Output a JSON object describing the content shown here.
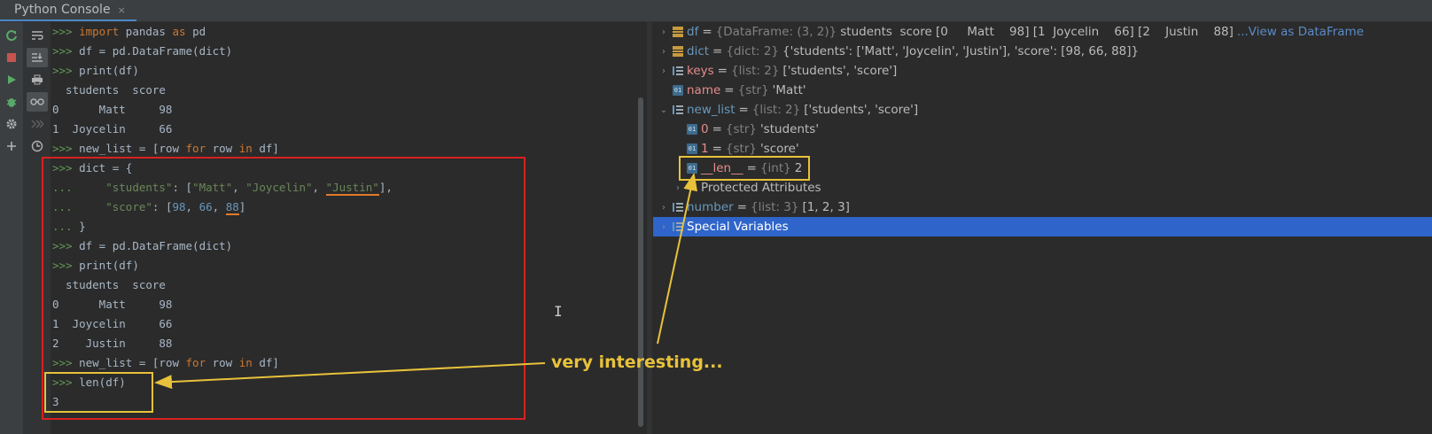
{
  "window": {
    "tab_title": "Python Console",
    "tab_close": "×"
  },
  "toolbar": {
    "icons": [
      "rerun-icon",
      "stop-icon",
      "run-icon",
      "debug-icon",
      "settings-icon",
      "add-icon"
    ]
  },
  "toolbar2": {
    "icons": [
      "soft-wrap-icon",
      "scroll-to-end-icon",
      "print-icon",
      "show-variables-icon",
      "history-forward-icon",
      "history-icon"
    ]
  },
  "console": {
    "prompt": ">>>",
    "continuation": "...",
    "lines": [
      {
        "prefix": ">>>",
        "code": [
          [
            "kw",
            "import"
          ],
          [
            "t",
            " pandas "
          ],
          [
            "kw",
            "as"
          ],
          [
            "t",
            " pd"
          ]
        ]
      },
      {
        "prefix": ">>>",
        "code": [
          [
            "t",
            "df = pd.DataFrame(dict)"
          ]
        ]
      },
      {
        "prefix": ">>>",
        "code": [
          [
            "t",
            "print(df)"
          ]
        ]
      },
      {
        "prefix": "",
        "code": [
          [
            "t",
            "  students  score"
          ]
        ]
      },
      {
        "prefix": "",
        "code": [
          [
            "t",
            "0      Matt     98"
          ]
        ]
      },
      {
        "prefix": "",
        "code": [
          [
            "t",
            "1  Joycelin     66"
          ]
        ]
      },
      {
        "prefix": ">>>",
        "code": [
          [
            "t",
            "new_list = [row "
          ],
          [
            "kw",
            "for"
          ],
          [
            "t",
            " row "
          ],
          [
            "kw",
            "in"
          ],
          [
            "t",
            " df]"
          ]
        ]
      },
      {
        "prefix": ">>>",
        "code": [
          [
            "t",
            "dict = {"
          ]
        ]
      },
      {
        "prefix": "...",
        "code": [
          [
            "t",
            "    "
          ],
          [
            "str",
            "\"students\""
          ],
          [
            "t",
            ": ["
          ],
          [
            "str",
            "\"Matt\""
          ],
          [
            "t",
            ", "
          ],
          [
            "str",
            "\"Joycelin\""
          ],
          [
            "t",
            ", "
          ],
          [
            "strul",
            "\"Justin\""
          ],
          [
            "t",
            "],"
          ]
        ]
      },
      {
        "prefix": "...",
        "code": [
          [
            "t",
            "    "
          ],
          [
            "str",
            "\"score\""
          ],
          [
            "t",
            ": ["
          ],
          [
            "num",
            "98"
          ],
          [
            "t",
            ", "
          ],
          [
            "num",
            "66"
          ],
          [
            "t",
            ", "
          ],
          [
            "numul",
            "88"
          ],
          [
            "t",
            "]"
          ]
        ]
      },
      {
        "prefix": "...",
        "code": [
          [
            "t",
            "}"
          ]
        ]
      },
      {
        "prefix": ">>>",
        "code": [
          [
            "t",
            "df = pd.DataFrame(dict)"
          ]
        ]
      },
      {
        "prefix": ">>>",
        "code": [
          [
            "t",
            "print(df)"
          ]
        ]
      },
      {
        "prefix": "",
        "code": [
          [
            "t",
            "  students  score"
          ]
        ]
      },
      {
        "prefix": "",
        "code": [
          [
            "t",
            "0      Matt     98"
          ]
        ]
      },
      {
        "prefix": "",
        "code": [
          [
            "t",
            "1  Joycelin     66"
          ]
        ]
      },
      {
        "prefix": "",
        "code": [
          [
            "t",
            "2    Justin     88"
          ]
        ]
      },
      {
        "prefix": ">>>",
        "code": [
          [
            "t",
            "new_list = [row "
          ],
          [
            "kw",
            "for"
          ],
          [
            "t",
            " row "
          ],
          [
            "kw",
            "in"
          ],
          [
            "t",
            " df]"
          ]
        ]
      },
      {
        "prefix": ">>>",
        "code": [
          [
            "t",
            "len(df)"
          ]
        ]
      },
      {
        "prefix": "",
        "code": [
          [
            "t",
            "3"
          ]
        ]
      }
    ]
  },
  "variables": [
    {
      "indent": 0,
      "chevron": "›",
      "icon": "df",
      "name": "df",
      "name_color": "blue",
      "type": "{DataFrame: (3, 2)}",
      "value": "students  score [0     Matt    98] [1  Joycelin    66] [2    Justin    88]",
      "link": "...View as DataFrame"
    },
    {
      "indent": 0,
      "chevron": "›",
      "icon": "df",
      "name": "dict",
      "name_color": "blue",
      "type": "{dict: 2}",
      "value": "{'students': ['Matt', 'Joycelin', 'Justin'], 'score': [98, 66, 88]}",
      "link": ""
    },
    {
      "indent": 0,
      "chevron": "›",
      "icon": "list",
      "name": "keys",
      "name_color": "red",
      "type": "{list: 2}",
      "value": "['students', 'score']",
      "link": ""
    },
    {
      "indent": 0,
      "chevron": "",
      "icon": "01",
      "name": "name",
      "name_color": "red",
      "type": "{str}",
      "value": "'Matt'",
      "link": ""
    },
    {
      "indent": 0,
      "chevron": "⌄",
      "icon": "list",
      "name": "new_list",
      "name_color": "blue",
      "type": "{list: 2}",
      "value": "['students', 'score']",
      "link": ""
    },
    {
      "indent": 1,
      "chevron": "",
      "icon": "01",
      "name": "0",
      "name_color": "red",
      "type": "{str}",
      "value": "'students'",
      "link": ""
    },
    {
      "indent": 1,
      "chevron": "",
      "icon": "01",
      "name": "1",
      "name_color": "red",
      "type": "{str}",
      "value": "'score'",
      "link": ""
    },
    {
      "indent": 1,
      "chevron": "",
      "icon": "01",
      "name": "__len__",
      "name_color": "red",
      "type": "{int}",
      "value": "2",
      "link": ""
    },
    {
      "indent": 1,
      "chevron": "›",
      "icon": "gear",
      "name": "Protected Attributes",
      "name_color": "plain",
      "type": "",
      "value": "",
      "link": ""
    },
    {
      "indent": 0,
      "chevron": "›",
      "icon": "list",
      "name": "number",
      "name_color": "blue",
      "type": "{list: 3}",
      "value": "[1, 2, 3]",
      "link": ""
    },
    {
      "indent": 0,
      "chevron": "›",
      "icon": "list",
      "name": "Special Variables",
      "name_color": "plain",
      "type": "",
      "value": "",
      "link": "",
      "selected": true
    }
  ],
  "annotation": {
    "text": "very interesting...",
    "color": "#e8c23a"
  },
  "colors": {
    "highlight_box": "#e8c23a",
    "red_box": "#d92020",
    "selection": "#2f65ca"
  }
}
